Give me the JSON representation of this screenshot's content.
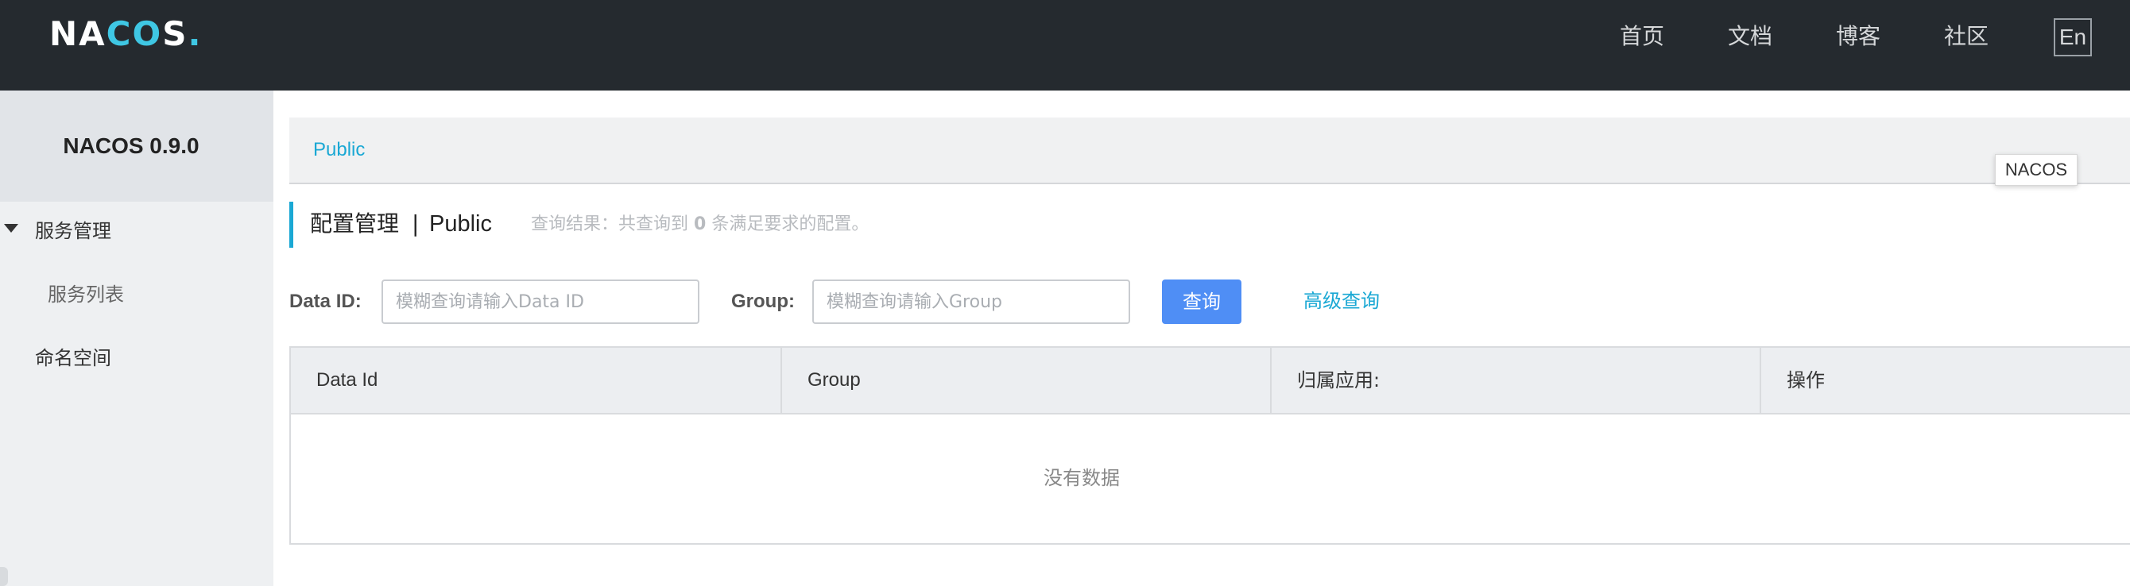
{
  "navbar": {
    "logo_text": "NACOS.",
    "links": [
      "首页",
      "文档",
      "博客",
      "社区"
    ],
    "lang_button": "En"
  },
  "sidebar": {
    "title": "NACOS 0.9.0",
    "items": [
      {
        "label": "服务管理",
        "expanded": true
      },
      {
        "label": "服务列表"
      },
      {
        "label": "命名空间"
      }
    ]
  },
  "namespace_bar": {
    "current": "Public",
    "tooltip": "NACOS"
  },
  "page": {
    "title": "配置管理",
    "separator": "|",
    "namespace": "Public",
    "summary_prefix": "查询结果：共查询到",
    "summary_count": "0",
    "summary_suffix": "条满足要求的配置。"
  },
  "search": {
    "data_id_label": "Data ID:",
    "data_id_placeholder": "模糊查询请输入Data ID",
    "group_label": "Group:",
    "group_placeholder": "模糊查询请输入Group",
    "query_button": "查询",
    "advanced_link": "高级查询"
  },
  "table": {
    "columns": [
      "Data Id",
      "Group",
      "归属应用:",
      "操作"
    ],
    "rows": [],
    "empty_text": "没有数据"
  },
  "colors": {
    "topbar": "#252a2f",
    "accent": "#1aa8d4",
    "primary_button": "#4f8ef5",
    "sidebar_bg": "#eef0f2"
  }
}
